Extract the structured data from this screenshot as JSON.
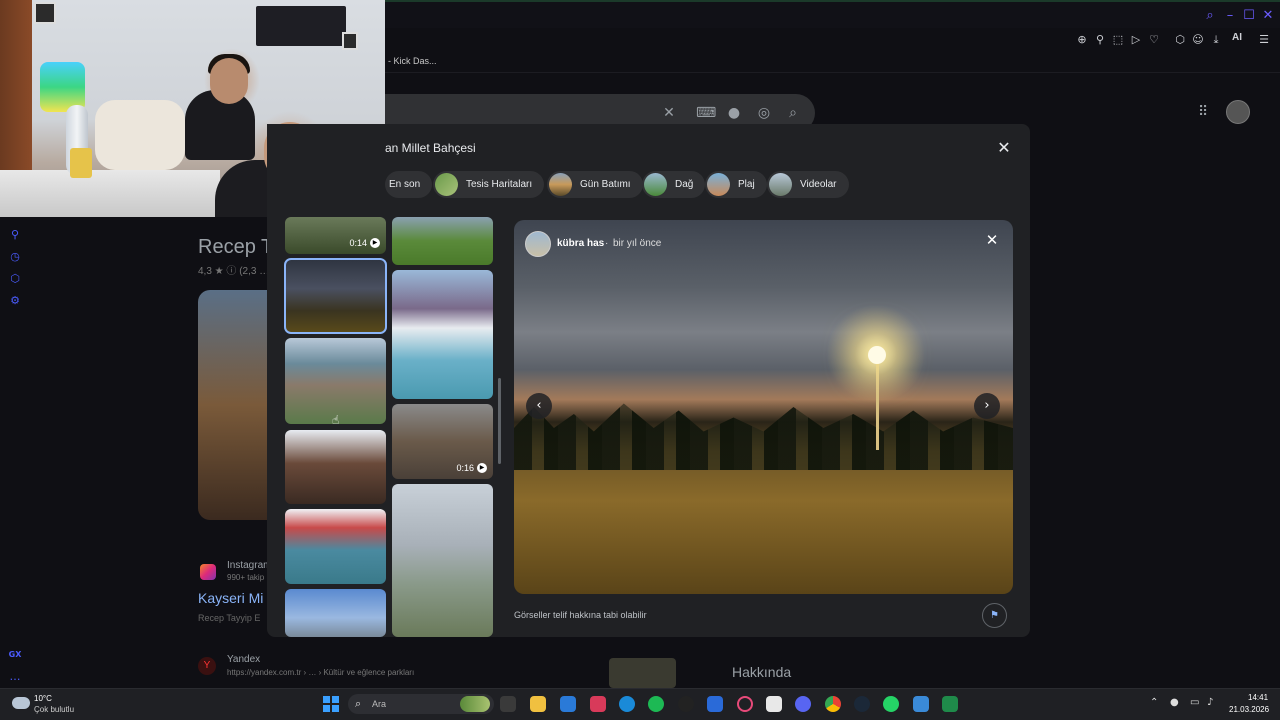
{
  "browser": {
    "bookmark_label": "- Kick Das...",
    "toolbar_ai_label": "AI",
    "accent_color": "#6b5cff"
  },
  "background_page": {
    "title": "Recep T",
    "rating": "4,3 ★  ⓘ (2,3 …",
    "instagram_label": "Instagram",
    "instagram_sub": "990+ takip",
    "result_title": "Kayseri Mi",
    "result_sub": "Recep Tayyip E",
    "yandex_label": "Yandex",
    "yandex_url": "https://yandex.com.tr › … › Kültür ve eğlence parkları",
    "about_heading": "Hakkında"
  },
  "modal": {
    "title": "an Millet Bahçesi",
    "chips": [
      {
        "label": "En son",
        "color": ""
      },
      {
        "label": "Tesis Haritaları",
        "color": "#7aa05a"
      },
      {
        "label": "Gün Batımı",
        "color": "#c89a5a"
      },
      {
        "label": "Dağ",
        "color": "#4a8a3a"
      },
      {
        "label": "Plaj",
        "color": "#7ab0d8"
      },
      {
        "label": "Videolar",
        "color": "#9ab0c0"
      }
    ],
    "thumbs": [
      {
        "badge": "0:14"
      },
      {
        "badge": ""
      },
      {
        "badge": ""
      },
      {
        "badge": ""
      },
      {
        "badge": ""
      },
      {
        "badge": ""
      },
      {
        "badge": ""
      },
      {
        "badge": ""
      },
      {
        "badge": "0:16"
      },
      {
        "badge": ""
      }
    ],
    "viewer": {
      "user_name": "kübra has",
      "separator": "·",
      "time_ago": "bir yıl önce",
      "copyright_note": "Görseller telif hakkına tabi olabilir"
    }
  },
  "taskbar": {
    "weather_temp": "10°C",
    "weather_desc": "Çok bulutlu",
    "search_label": "Ara",
    "clock_time": "14:41",
    "clock_date": "21.03.2026"
  },
  "left_rail": {
    "bottom_label": "GX"
  }
}
